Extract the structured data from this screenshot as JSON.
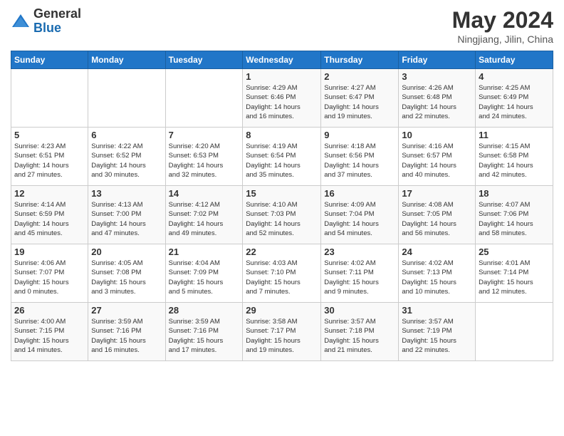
{
  "header": {
    "logo_general": "General",
    "logo_blue": "Blue",
    "month_title": "May 2024",
    "location": "Ningjiang, Jilin, China"
  },
  "weekdays": [
    "Sunday",
    "Monday",
    "Tuesday",
    "Wednesday",
    "Thursday",
    "Friday",
    "Saturday"
  ],
  "weeks": [
    [
      {
        "day": "",
        "info": ""
      },
      {
        "day": "",
        "info": ""
      },
      {
        "day": "",
        "info": ""
      },
      {
        "day": "1",
        "info": "Sunrise: 4:29 AM\nSunset: 6:46 PM\nDaylight: 14 hours\nand 16 minutes."
      },
      {
        "day": "2",
        "info": "Sunrise: 4:27 AM\nSunset: 6:47 PM\nDaylight: 14 hours\nand 19 minutes."
      },
      {
        "day": "3",
        "info": "Sunrise: 4:26 AM\nSunset: 6:48 PM\nDaylight: 14 hours\nand 22 minutes."
      },
      {
        "day": "4",
        "info": "Sunrise: 4:25 AM\nSunset: 6:49 PM\nDaylight: 14 hours\nand 24 minutes."
      }
    ],
    [
      {
        "day": "5",
        "info": "Sunrise: 4:23 AM\nSunset: 6:51 PM\nDaylight: 14 hours\nand 27 minutes."
      },
      {
        "day": "6",
        "info": "Sunrise: 4:22 AM\nSunset: 6:52 PM\nDaylight: 14 hours\nand 30 minutes."
      },
      {
        "day": "7",
        "info": "Sunrise: 4:20 AM\nSunset: 6:53 PM\nDaylight: 14 hours\nand 32 minutes."
      },
      {
        "day": "8",
        "info": "Sunrise: 4:19 AM\nSunset: 6:54 PM\nDaylight: 14 hours\nand 35 minutes."
      },
      {
        "day": "9",
        "info": "Sunrise: 4:18 AM\nSunset: 6:56 PM\nDaylight: 14 hours\nand 37 minutes."
      },
      {
        "day": "10",
        "info": "Sunrise: 4:16 AM\nSunset: 6:57 PM\nDaylight: 14 hours\nand 40 minutes."
      },
      {
        "day": "11",
        "info": "Sunrise: 4:15 AM\nSunset: 6:58 PM\nDaylight: 14 hours\nand 42 minutes."
      }
    ],
    [
      {
        "day": "12",
        "info": "Sunrise: 4:14 AM\nSunset: 6:59 PM\nDaylight: 14 hours\nand 45 minutes."
      },
      {
        "day": "13",
        "info": "Sunrise: 4:13 AM\nSunset: 7:00 PM\nDaylight: 14 hours\nand 47 minutes."
      },
      {
        "day": "14",
        "info": "Sunrise: 4:12 AM\nSunset: 7:02 PM\nDaylight: 14 hours\nand 49 minutes."
      },
      {
        "day": "15",
        "info": "Sunrise: 4:10 AM\nSunset: 7:03 PM\nDaylight: 14 hours\nand 52 minutes."
      },
      {
        "day": "16",
        "info": "Sunrise: 4:09 AM\nSunset: 7:04 PM\nDaylight: 14 hours\nand 54 minutes."
      },
      {
        "day": "17",
        "info": "Sunrise: 4:08 AM\nSunset: 7:05 PM\nDaylight: 14 hours\nand 56 minutes."
      },
      {
        "day": "18",
        "info": "Sunrise: 4:07 AM\nSunset: 7:06 PM\nDaylight: 14 hours\nand 58 minutes."
      }
    ],
    [
      {
        "day": "19",
        "info": "Sunrise: 4:06 AM\nSunset: 7:07 PM\nDaylight: 15 hours\nand 0 minutes."
      },
      {
        "day": "20",
        "info": "Sunrise: 4:05 AM\nSunset: 7:08 PM\nDaylight: 15 hours\nand 3 minutes."
      },
      {
        "day": "21",
        "info": "Sunrise: 4:04 AM\nSunset: 7:09 PM\nDaylight: 15 hours\nand 5 minutes."
      },
      {
        "day": "22",
        "info": "Sunrise: 4:03 AM\nSunset: 7:10 PM\nDaylight: 15 hours\nand 7 minutes."
      },
      {
        "day": "23",
        "info": "Sunrise: 4:02 AM\nSunset: 7:11 PM\nDaylight: 15 hours\nand 9 minutes."
      },
      {
        "day": "24",
        "info": "Sunrise: 4:02 AM\nSunset: 7:13 PM\nDaylight: 15 hours\nand 10 minutes."
      },
      {
        "day": "25",
        "info": "Sunrise: 4:01 AM\nSunset: 7:14 PM\nDaylight: 15 hours\nand 12 minutes."
      }
    ],
    [
      {
        "day": "26",
        "info": "Sunrise: 4:00 AM\nSunset: 7:15 PM\nDaylight: 15 hours\nand 14 minutes."
      },
      {
        "day": "27",
        "info": "Sunrise: 3:59 AM\nSunset: 7:16 PM\nDaylight: 15 hours\nand 16 minutes."
      },
      {
        "day": "28",
        "info": "Sunrise: 3:59 AM\nSunset: 7:16 PM\nDaylight: 15 hours\nand 17 minutes."
      },
      {
        "day": "29",
        "info": "Sunrise: 3:58 AM\nSunset: 7:17 PM\nDaylight: 15 hours\nand 19 minutes."
      },
      {
        "day": "30",
        "info": "Sunrise: 3:57 AM\nSunset: 7:18 PM\nDaylight: 15 hours\nand 21 minutes."
      },
      {
        "day": "31",
        "info": "Sunrise: 3:57 AM\nSunset: 7:19 PM\nDaylight: 15 hours\nand 22 minutes."
      },
      {
        "day": "",
        "info": ""
      }
    ]
  ]
}
